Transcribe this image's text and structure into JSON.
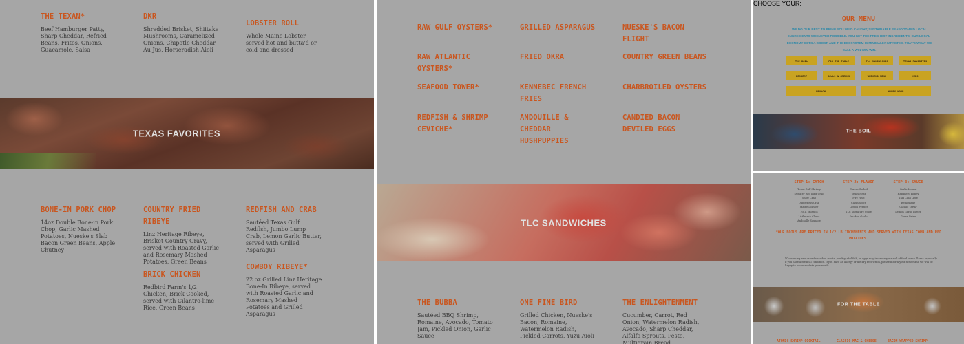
{
  "panel1": {
    "top_items": [
      {
        "name": "THE TEXAN*",
        "desc": "Beef Hamburger Patty, Sharp Cheddar, Refried Beans, Fritos, Onions, Guacamole, Salsa"
      },
      {
        "name": "DKR",
        "desc": "Shredded Brisket, Shiitake Mushrooms, Caramelized Onions, Chipotle Cheddar, Au Jus, Horseradish Aioli"
      },
      {
        "name": "LOBSTER ROLL",
        "desc": "Whole Maine Lobster served hot and butta'd or cold and dressed"
      }
    ],
    "banner_title": "TEXAS FAVORITES",
    "bottom_items": [
      {
        "name": "BONE-IN PORK CHOP",
        "desc": "14oz Double Bone-in Pork Chop, Garlic Mashed Potatoes, Nueske's Slab Bacon Green Beans, Apple Chutney"
      },
      {
        "name": "COUNTRY FRIED RIBEYE",
        "desc": "Linz Heritage Ribeye, Brisket Country Gravy, served with Roasted Garlic and Rosemary Mashed Potatoes, Green Beans"
      },
      {
        "name": "REDFISH AND CRAB",
        "desc": "Sautéed Texas Gulf Redfish, Jumbo Lump Crab, Lemon Garlic Butter, served with Grilled Asparagus"
      },
      {
        "name": "BRICK CHICKEN",
        "desc": "Redbird Farm's 1/2 Chicken, Brick Cooked, served with Cilantro-lime Rice, Green Beans"
      },
      {
        "name": "COWBOY RIBEYE*",
        "desc": "22 oz Grilled Linz Heritage Bone-In Ribeye, served with Roasted Garlic and Rosemary Mashed Potatoes and Grilled Asparagus"
      }
    ]
  },
  "panel2": {
    "col1": [
      "RAW GULF OYSTERS*",
      "RAW ATLANTIC OYSTERS*",
      "SEAFOOD TOWER*",
      "REDFISH & SHRIMP CEVICHE*"
    ],
    "col2": [
      "GRILLED ASPARAGUS",
      "FRIED OKRA",
      "KENNEBEC FRENCH FRIES",
      "ANDOUILLE & CHEDDAR HUSHPUPPIES"
    ],
    "col3": [
      "NUESKE'S BACON FLIGHT",
      "COUNTRY GREEN BEANS",
      "CHARBROILED OYSTERS",
      "CANDIED BACON DEVILED EGGS"
    ],
    "banner_title": "TLC SANDWICHES",
    "bottom_items": [
      {
        "name": "THE BUBBA",
        "desc": "Sautéed BBQ Shrimp, Romaine, Avocado, Tomato Jam, Pickled Onion, Garlic Sauce"
      },
      {
        "name": "ONE FINE BIRD",
        "desc": "Grilled Chicken, Nueske's Bacon, Romaine, Watermelon Radish, Pickled Carrots, Yuzu Aioli"
      },
      {
        "name": "THE ENLIGHTENMENT",
        "desc": "Cucumber, Carrot, Red Onion, Watermelon Radish, Avocado, Sharp Cheddar, Alfalfa Sprouts, Pesto, Multigrain Bread"
      }
    ]
  },
  "panel3": {
    "title": "OUR MENU",
    "intro": "WE DO OUR BEST TO BRING YOU WILD CAUGHT, SUSTAINABLE SEAFOOD AND LOCAL INGREDIENTS WHENEVER POSSIBLE. YOU GET THE FRESHEST INGREDIENTS, OUR LOCAL ECONOMY GETS A BOOST, AND THE ECOSYSTEM IS MINIMALLY IMPACTED. THAT'S WHAT WE CALL A WIN-WIN-WIN.",
    "buttons_row1": [
      "THE BOIL",
      "FOR THE TABLE",
      "TLC SANDWICHES",
      "TEXAS FAVORITES"
    ],
    "buttons_row2": [
      "DESSERT",
      "BOWLS & GREENS",
      "WEEKEND MENU",
      "KIDS"
    ],
    "buttons_row3": [
      "BRUNCH",
      "HAPPY HOUR"
    ],
    "banner_title": "THE BOIL",
    "choose_label": "CHOOSE YOUR:"
  },
  "panel4": {
    "steps": [
      {
        "title": "STEP 1: CATCH",
        "items": [
          "Texas Gulf Shrimp",
          "Sweater Red King Crab",
          "Snow Crab",
          "Dungeness Crab",
          "Maine Lobster",
          "P.E.I. Mussels",
          "Littleneck Clams",
          "Andouille Sausage"
        ]
      },
      {
        "title": "STEP 2: FLAVOR",
        "items": [
          "Classic Boiled",
          "Texas Heat",
          "Fire Heat",
          "Cajun Spice",
          "Lemon Pepper",
          "TLC Signature Spice",
          "Smoked Garlic"
        ]
      },
      {
        "title": "STEP 3: SAUCE",
        "items": [
          "Garlic Lemon",
          "Habanero Honey",
          "Thai Chili Lime",
          "Remoulade",
          "Classic Tartar",
          "Lemon Garlic Butter",
          "Green Brine"
        ]
      }
    ],
    "note": "*OUR BOILS ARE PRICED IN 1/2 LB INCREMENTS AND SERVED WITH TEXAS CORN AND RED POTATOES.",
    "disclaimer": "*Consuming raw or undercooked meats, poultry, shellfish, or eggs may increase your risk of food borne illness especially if you have a medical condition. If you have an allergy or dietary restriction, please inform your server and we will be happy to accommodate your needs.",
    "banner_title": "FOR THE TABLE",
    "bottom_labels": [
      "ATOMIC SHRIMP COCKTAIL",
      "CLASSIC MAC & CHEESE",
      "BACON WRAPPED SHRIMP"
    ]
  }
}
